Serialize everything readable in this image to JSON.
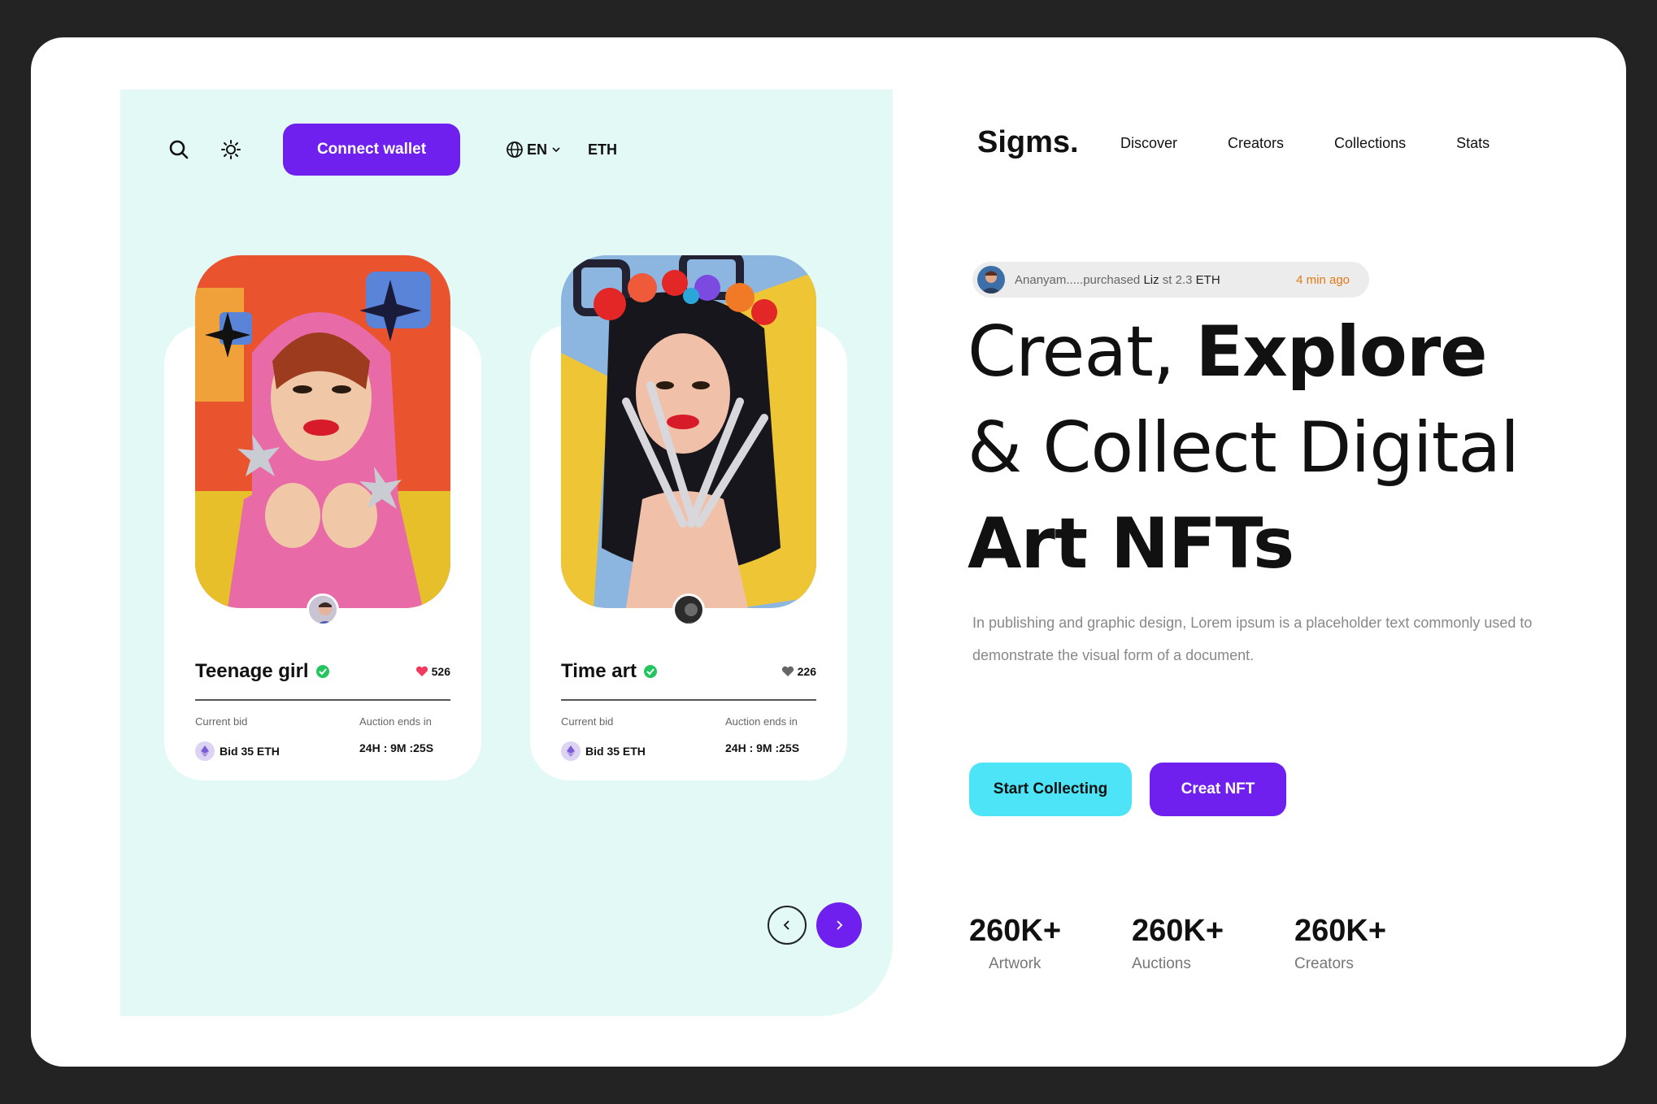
{
  "topbar": {
    "connect_label": "Connect wallet",
    "language": "EN",
    "currency": "ETH"
  },
  "cards": [
    {
      "title": "Teenage girl",
      "likes": "526",
      "likes_color": "#f23b5f",
      "bid_label": "Current bid",
      "bid_value": "Bid 35 ETH",
      "auction_label": "Auction ends in",
      "auction_value": "24H : 9M :25S"
    },
    {
      "title": "Time art",
      "likes": "226",
      "likes_color": "#666666",
      "bid_label": "Current bid",
      "bid_value": "Bid 35 ETH",
      "auction_label": "Auction ends in",
      "auction_value": "24H : 9M :25S"
    }
  ],
  "brand": "Sigms.",
  "nav": [
    "Discover",
    "Creators",
    "Collections",
    "Stats"
  ],
  "activity": {
    "user": "Ananyam.....purchased",
    "item": "Liz",
    "price_prefix": "st 2.3",
    "price_unit": "ETH",
    "time": "4 min ago"
  },
  "headline": {
    "line1_light": "Creat, ",
    "line1_bold": "Explore",
    "line2": "& Collect Digital",
    "line3": "Art NFTs"
  },
  "description": "In publishing and graphic design, Lorem ipsum is a placeholder text commonly used to demonstrate the visual form of a document.",
  "cta": {
    "primary": "Start Collecting",
    "secondary": "Creat NFT"
  },
  "stats": [
    {
      "value": "260K+",
      "label": "Artwork"
    },
    {
      "value": "260K+",
      "label": "Auctions"
    },
    {
      "value": "260K+",
      "label": "Creators"
    }
  ],
  "colors": {
    "accent": "#6f20ee",
    "cyan": "#4ce4f6",
    "panel": "#e2f9f5",
    "verified": "#22c55e",
    "activity_time": "#e07a16"
  }
}
